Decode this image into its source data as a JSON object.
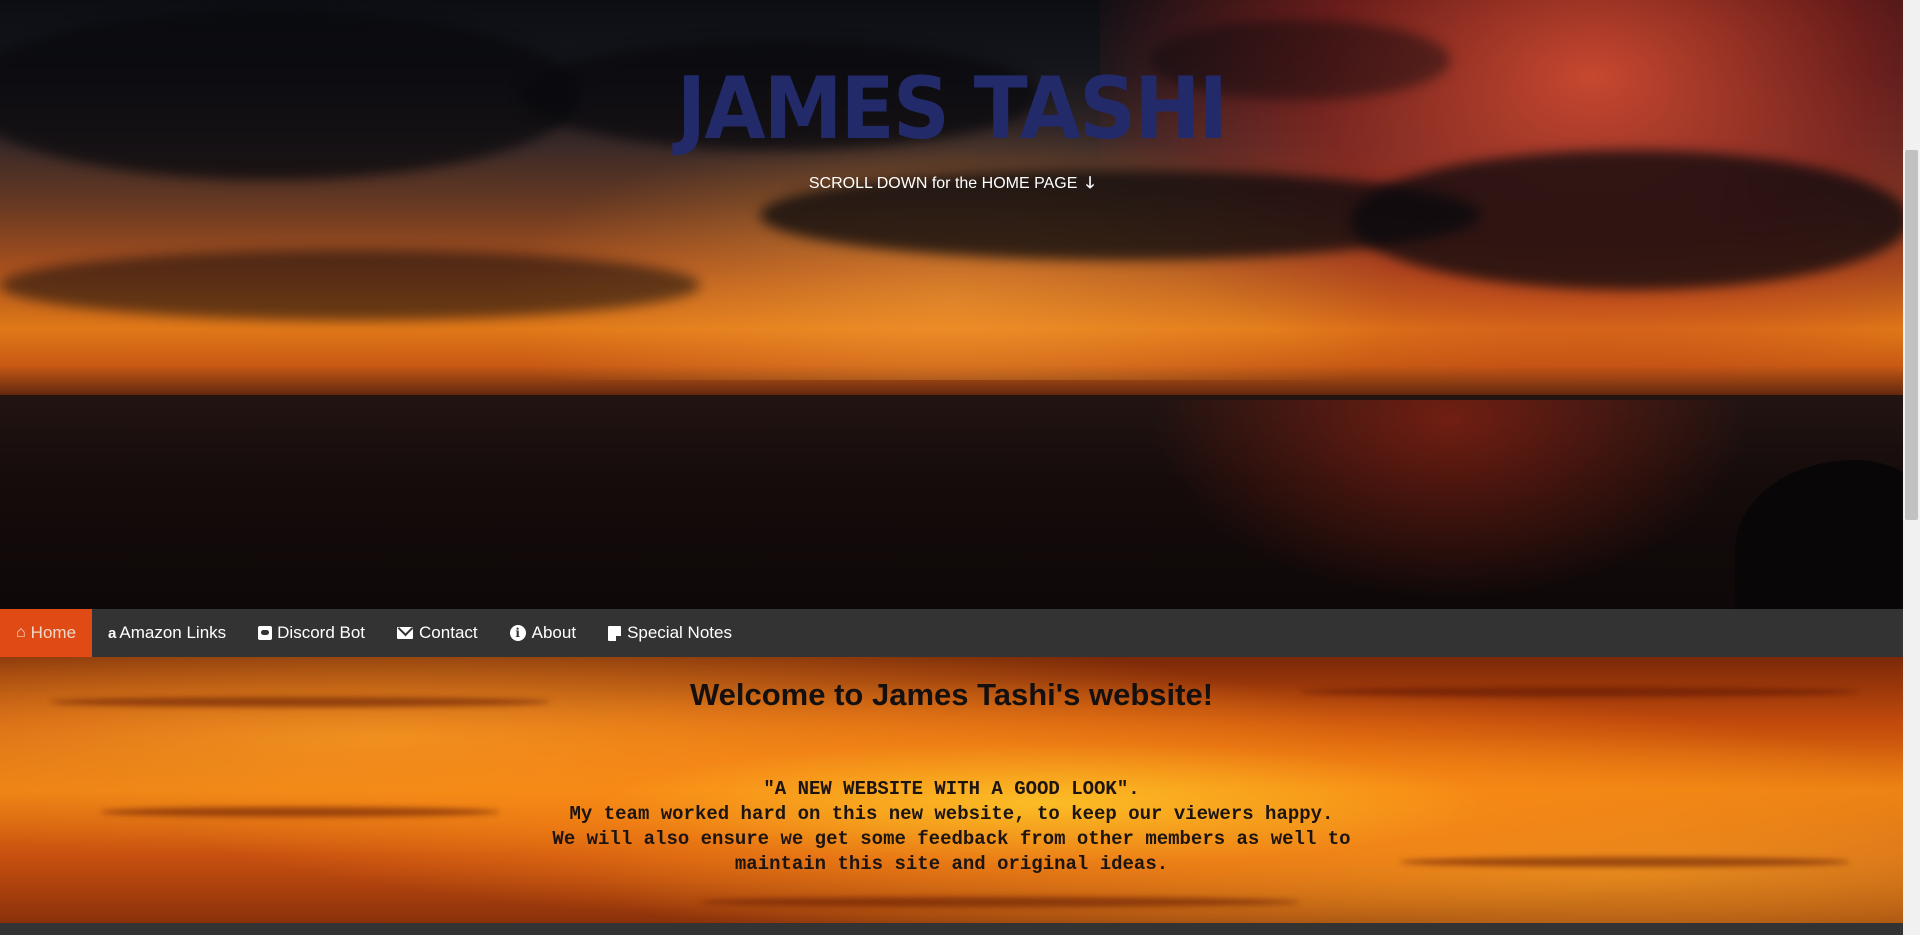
{
  "hero": {
    "title": "JAMES TASHI",
    "subtitle": "SCROLL DOWN for the HOME PAGE",
    "subtitle_icon": "arrow-down-icon",
    "arrow_glyph": "🡓"
  },
  "nav": {
    "items": [
      {
        "label": "Home",
        "icon": "home-icon",
        "active": true
      },
      {
        "label": "Amazon Links",
        "icon": "amazon-icon",
        "active": false
      },
      {
        "label": "Discord Bot",
        "icon": "discord-icon",
        "active": false
      },
      {
        "label": "Contact",
        "icon": "envelope-icon",
        "active": false
      },
      {
        "label": "About",
        "icon": "info-icon",
        "active": false
      },
      {
        "label": "Special Notes",
        "icon": "note-icon",
        "active": false
      }
    ],
    "active_color": "#e04a14",
    "bar_color": "#333333"
  },
  "content": {
    "heading": "Welcome to James Tashi's website!",
    "quote_lines": [
      "\"A NEW WEBSITE WITH A GOOD LOOK\".",
      "My team worked hard on this new website, to keep our viewers happy.",
      "We will also ensure we get some feedback from other members as well to",
      "maintain this site and original ideas."
    ]
  },
  "colors": {
    "title": "#232a6a"
  }
}
